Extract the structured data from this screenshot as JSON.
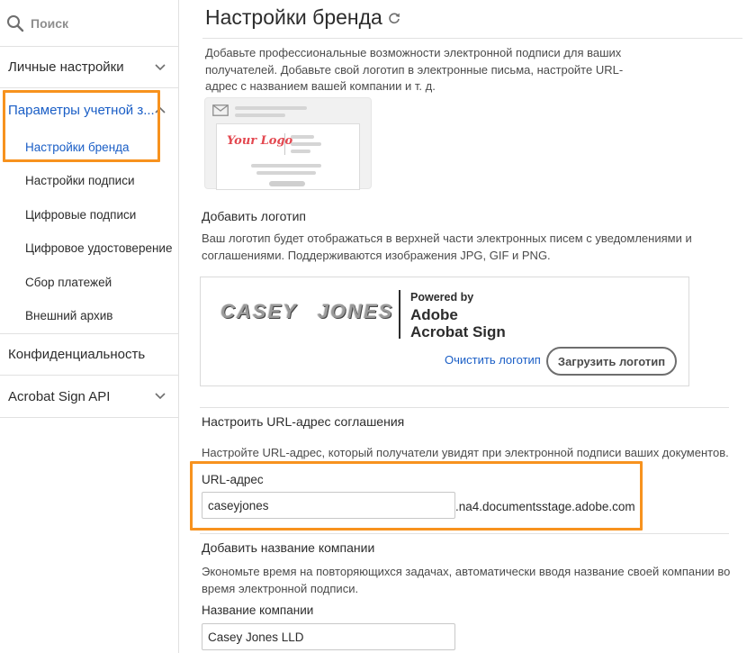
{
  "sidebar": {
    "search_placeholder": "Поиск",
    "personal_settings": "Личные настройки",
    "account_settings": "Параметры учетной з...",
    "sub_items": [
      "Настройки бренда",
      "Настройки подписи",
      "Цифровые подписи",
      "Цифровое удостоверение",
      "Сбор платежей",
      "Внешний архив"
    ],
    "privacy": "Конфиденциальность",
    "api": "Acrobat Sign API"
  },
  "main": {
    "title": "Настройки бренда",
    "intro": "Добавьте профессиональные возможности электронной подписи для ваших получателей. Добавьте свой логотип в электронные письма, настройте URL-адрес с названием вашей компании и т. д.",
    "preview": {
      "logo_text": "Your Logo"
    },
    "logo_section": {
      "title": "Добавить логотип",
      "description": "Ваш логотип будет отображаться в верхней части электронных писем с уведомлениями и соглашениями. Поддерживаются изображения JPG, GIF и PNG.",
      "current_logo_word1": "CASEY",
      "current_logo_word2": "JONES",
      "powered_by": "Powered by",
      "powered_brand_line1": "Adobe",
      "powered_brand_line2": "Acrobat Sign",
      "clear_label": "Очистить логотип",
      "upload_label": "Загрузить логотип"
    },
    "url_section": {
      "title": "Настроить URL-адрес соглашения",
      "description": "Настройте URL-адрес, который получатели увидят при электронной подписи ваших документов.",
      "field_label": "URL-адрес",
      "value": "caseyjones",
      "suffix": ".na4.documentsstage.adobe.com"
    },
    "company_section": {
      "title": "Добавить название компании",
      "description": "Экономьте время на повторяющихся задачах, автоматически вводя название своей компании во время электронной подписи.",
      "field_label": "Название компании",
      "value": "Casey Jones LLD"
    }
  },
  "colors": {
    "accent_blue": "#1a5ec6",
    "highlight_orange": "#f7921e",
    "logo_red": "#e34850"
  },
  "icons": [
    "search-icon",
    "chevron-down-icon",
    "chevron-up-icon",
    "refresh-icon",
    "envelope-icon"
  ]
}
